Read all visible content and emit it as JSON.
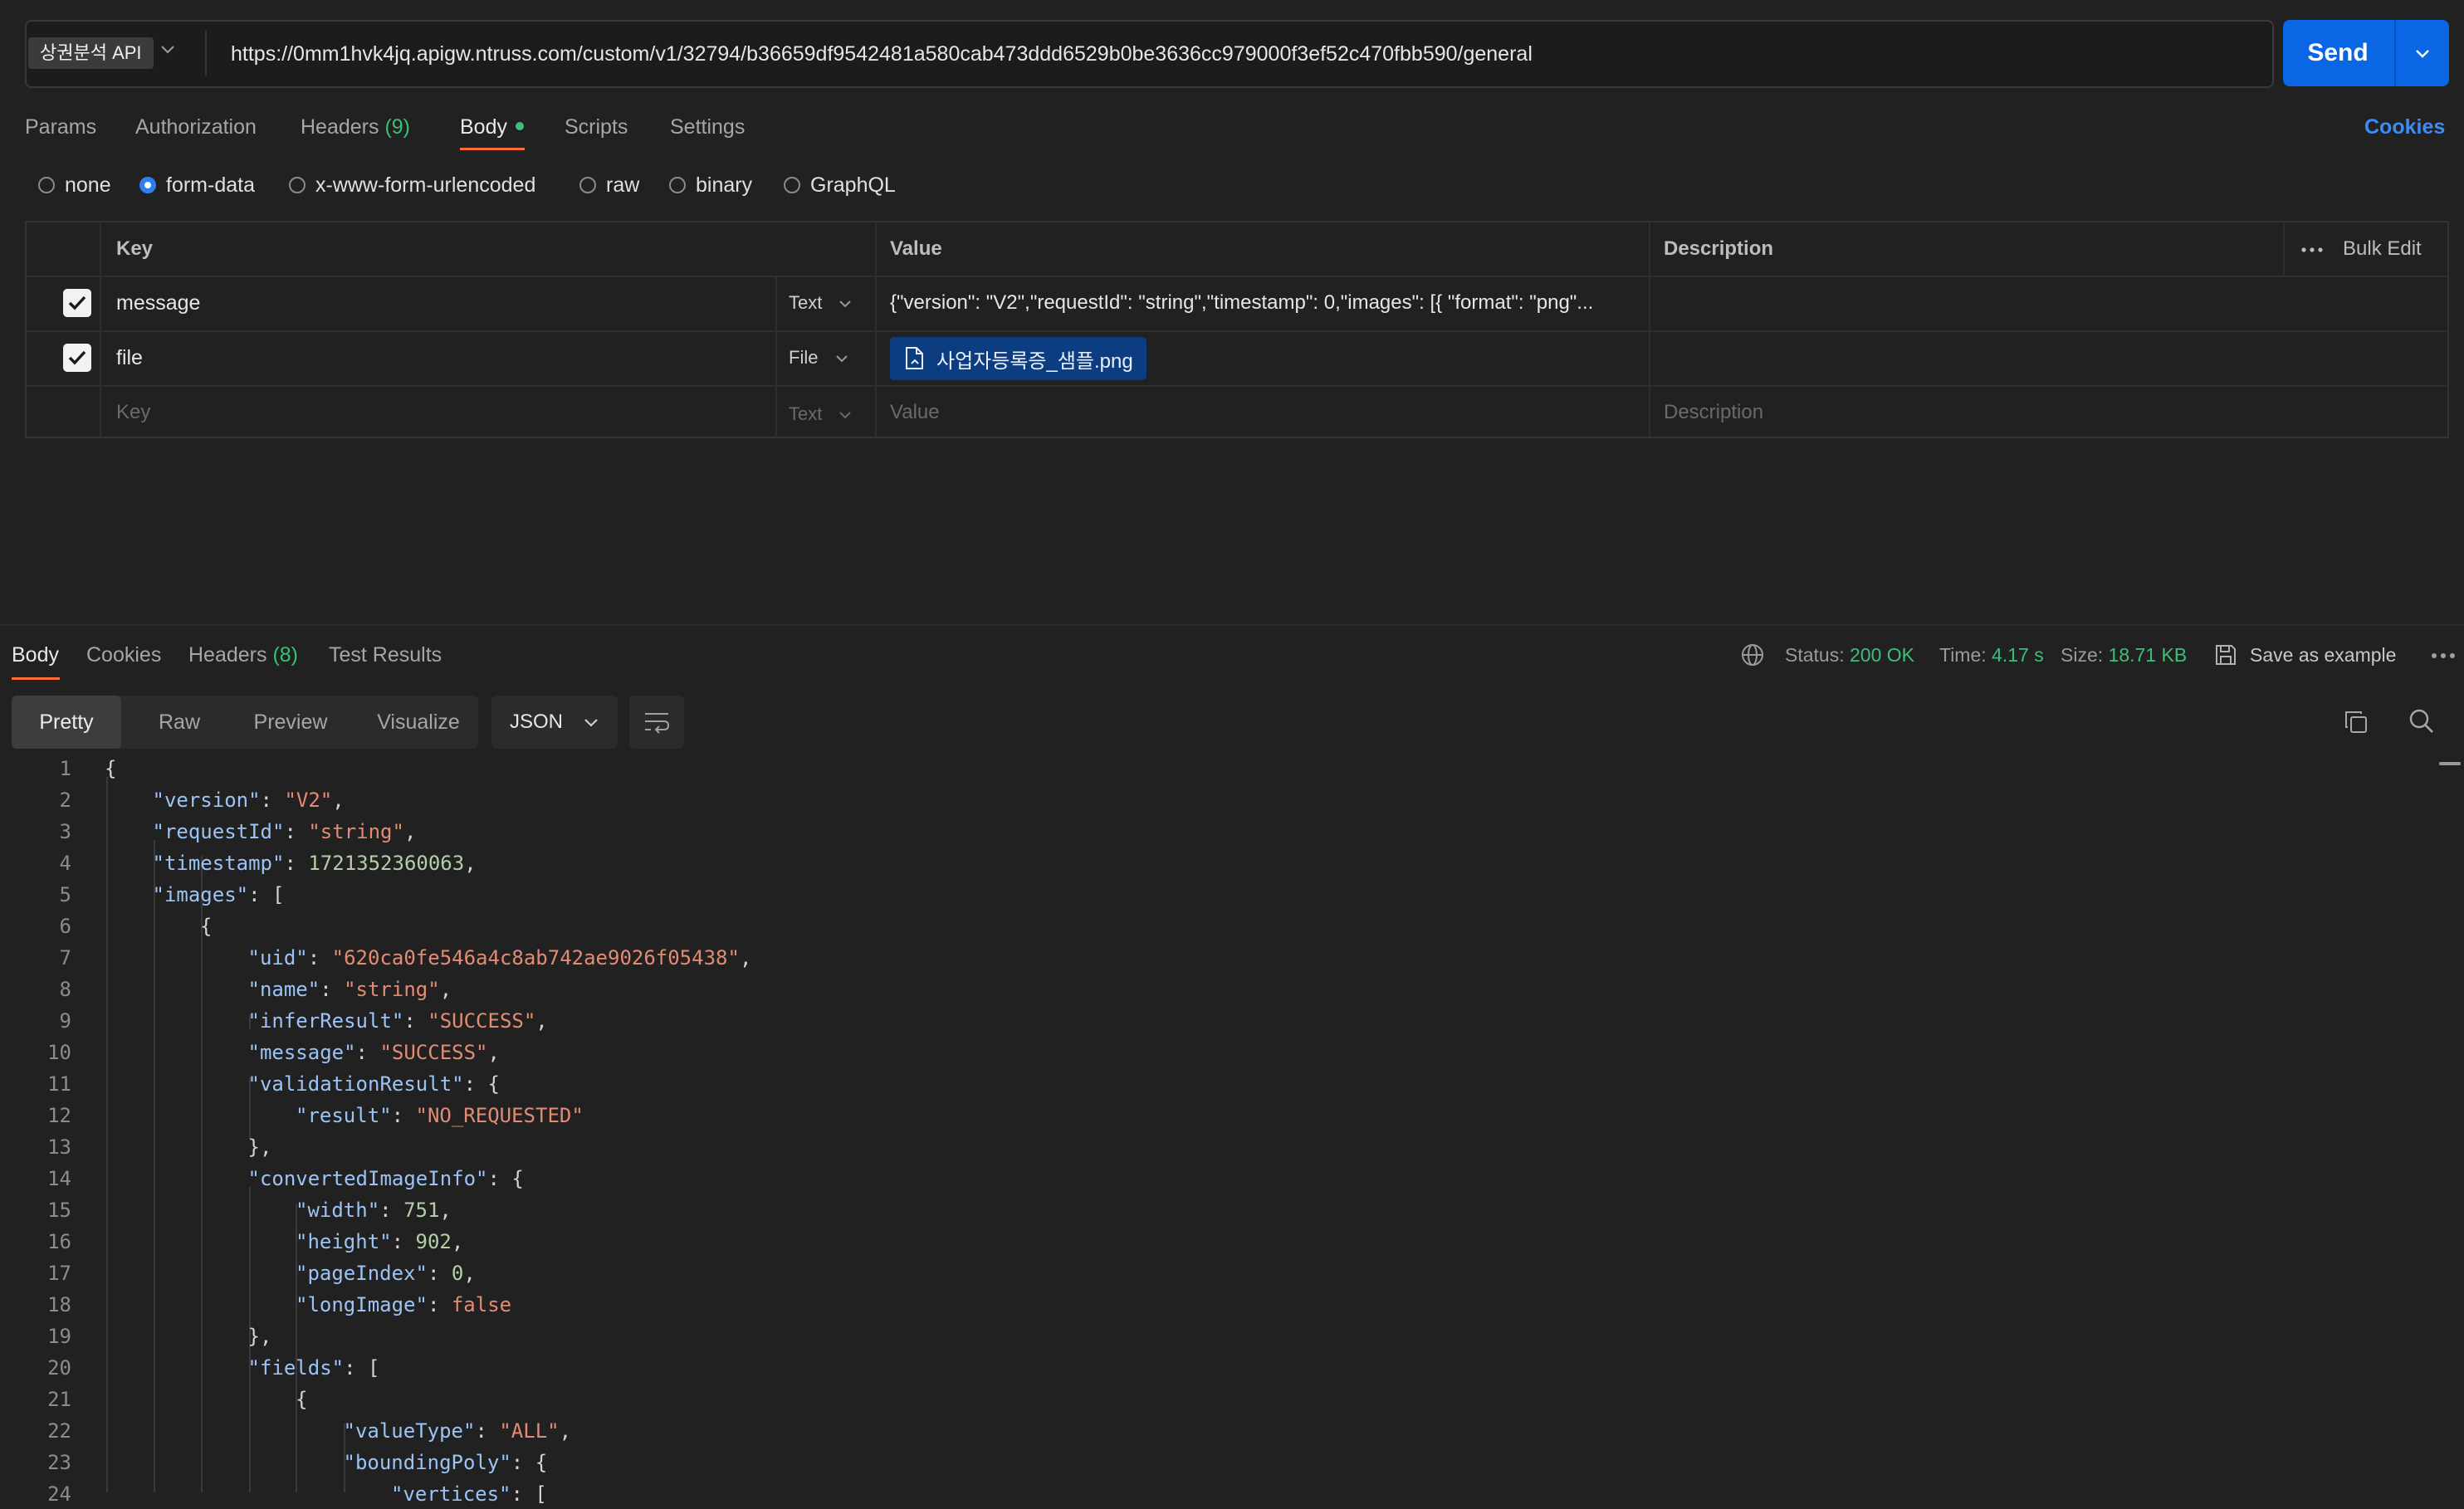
{
  "request": {
    "method_label": "상권분석 API",
    "url": "https://0mm1hvk4jq.apigw.ntruss.com/custom/v1/32794/b36659df9542481a580cab473ddd6529b0be3636cc979000f3ef52c470fbb590/general",
    "send_label": "Send",
    "tabs": {
      "params": "Params",
      "authorization": "Authorization",
      "headers": "Headers",
      "headers_count": "(9)",
      "body": "Body",
      "scripts": "Scripts",
      "settings": "Settings"
    },
    "cookies_label": "Cookies",
    "body_types": [
      "none",
      "form-data",
      "x-www-form-urlencoded",
      "raw",
      "binary",
      "GraphQL"
    ],
    "selected_body_type": "form-data"
  },
  "form_table": {
    "headers": {
      "key": "Key",
      "value": "Value",
      "description": "Description",
      "bulk_edit": "Bulk Edit"
    },
    "rows": [
      {
        "checked": true,
        "key": "message",
        "type": "Text",
        "value": "{\"version\": \"V2\",\"requestId\": \"string\",\"timestamp\": 0,\"images\": [{ \"format\": \"png\"...",
        "description": ""
      },
      {
        "checked": true,
        "key": "file",
        "type": "File",
        "value": "사업자등록증_샘플.png",
        "description": ""
      }
    ],
    "empty_row": {
      "key_placeholder": "Key",
      "type": "Text",
      "value_placeholder": "Value",
      "description_placeholder": "Description"
    }
  },
  "response": {
    "tabs": {
      "body": "Body",
      "cookies": "Cookies",
      "headers": "Headers",
      "headers_count": "(8)",
      "test_results": "Test Results"
    },
    "status_label": "Status:",
    "status_value": "200 OK",
    "time_label": "Time:",
    "time_value": "4.17 s",
    "size_label": "Size:",
    "size_value": "18.71 KB",
    "save_example_label": "Save as example",
    "view_modes": [
      "Pretty",
      "Raw",
      "Preview",
      "Visualize"
    ],
    "format": "JSON"
  },
  "code_lines": [
    "{",
    "\"version\": \"V2\",",
    "\"requestId\": \"string\",",
    "\"timestamp\": 1721352360063,",
    "\"images\": [",
    "{",
    "\"uid\": \"620ca0fe546a4c8ab742ae9026f05438\",",
    "\"name\": \"string\",",
    "\"inferResult\": \"SUCCESS\",",
    "\"message\": \"SUCCESS\",",
    "\"validationResult\": {",
    "\"result\": \"NO_REQUESTED\"",
    "},",
    "\"convertedImageInfo\": {",
    "\"width\": 751,",
    "\"height\": 902,",
    "\"pageIndex\": 0,",
    "\"longImage\": false",
    "},",
    "\"fields\": [",
    "{",
    "\"valueType\": \"ALL\",",
    "\"boundingPoly\": {",
    "\"vertices\": ["
  ],
  "colors": {
    "accent_blue": "#0a66e4",
    "tab_underline": "#ff6c37",
    "success_green": "#3cbf79"
  }
}
